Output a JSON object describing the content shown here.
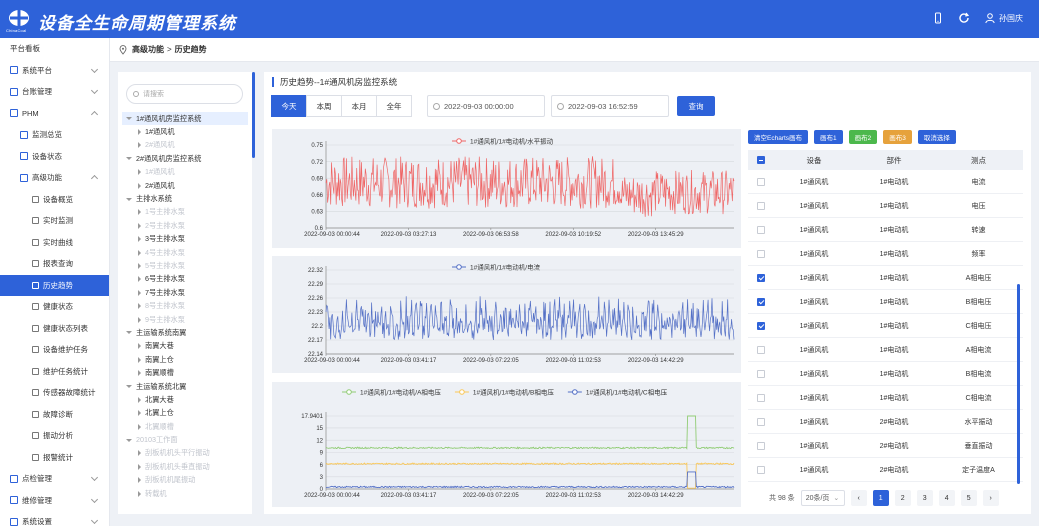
{
  "app": {
    "title": "设备全生命周期管理系统",
    "logo_text": "ChinaCoal",
    "user": "孙国庆"
  },
  "breadcrumb": {
    "root": "高级功能",
    "sep": ">",
    "current": "历史趋势"
  },
  "sidebar": [
    {
      "label": "平台看板",
      "icon": "",
      "level": 0,
      "expand": ""
    },
    {
      "label": "系统平台",
      "icon": "monitor-icon",
      "level": 0,
      "expand": "down"
    },
    {
      "label": "台账管理",
      "icon": "ledger-icon",
      "level": 0,
      "expand": "down"
    },
    {
      "label": "PHM",
      "icon": "phm-icon",
      "level": 0,
      "expand": "up"
    },
    {
      "label": "监测总览",
      "icon": "overview-icon",
      "level": 1,
      "expand": ""
    },
    {
      "label": "设备状态",
      "icon": "device-status-icon",
      "level": 1,
      "expand": ""
    },
    {
      "label": "高级功能",
      "icon": "advanced-icon",
      "level": 1,
      "expand": "up"
    },
    {
      "label": "设备概览",
      "icon": "page-icon",
      "level": 2,
      "expand": ""
    },
    {
      "label": "实时监测",
      "icon": "page-icon",
      "level": 2,
      "expand": ""
    },
    {
      "label": "实时曲线",
      "icon": "page-icon",
      "level": 2,
      "expand": ""
    },
    {
      "label": "报表查询",
      "icon": "page-icon",
      "level": 2,
      "expand": ""
    },
    {
      "label": "历史趋势",
      "icon": "page-icon",
      "level": 2,
      "expand": "",
      "active": true
    },
    {
      "label": "健康状态",
      "icon": "page-icon",
      "level": 2,
      "expand": ""
    },
    {
      "label": "健康状态列表",
      "icon": "page-icon",
      "level": 2,
      "expand": ""
    },
    {
      "label": "设备维护任务",
      "icon": "page-icon",
      "level": 2,
      "expand": ""
    },
    {
      "label": "维护任务统计",
      "icon": "page-icon",
      "level": 2,
      "expand": ""
    },
    {
      "label": "传感器故障统计",
      "icon": "page-icon",
      "level": 2,
      "expand": ""
    },
    {
      "label": "故障诊断",
      "icon": "page-icon",
      "level": 2,
      "expand": ""
    },
    {
      "label": "振动分析",
      "icon": "page-icon",
      "level": 2,
      "expand": ""
    },
    {
      "label": "报警统计",
      "icon": "page-icon",
      "level": 2,
      "expand": ""
    },
    {
      "label": "点检管理",
      "icon": "inspect-icon",
      "level": 0,
      "expand": "down"
    },
    {
      "label": "维修管理",
      "icon": "repair-icon",
      "level": 0,
      "expand": "down"
    },
    {
      "label": "系统设置",
      "icon": "settings-icon",
      "level": 0,
      "expand": "down"
    }
  ],
  "tree": {
    "search_placeholder": "请搜索",
    "nodes": [
      {
        "label": "1#通风机房监控系统",
        "level": 0,
        "toggle": "down",
        "selected": true
      },
      {
        "label": "1#通风机",
        "level": 1,
        "toggle": "right"
      },
      {
        "label": "2#通风机",
        "level": 1,
        "toggle": "right",
        "disabled": true
      },
      {
        "label": "2#通风机房监控系统",
        "level": 0,
        "toggle": "down"
      },
      {
        "label": "1#通风机",
        "level": 1,
        "toggle": "right",
        "disabled": true
      },
      {
        "label": "2#通风机",
        "level": 1,
        "toggle": "right"
      },
      {
        "label": "主排水系统",
        "level": 0,
        "toggle": "down"
      },
      {
        "label": "1号主排水泵",
        "level": 1,
        "toggle": "right",
        "disabled": true
      },
      {
        "label": "2号主排水泵",
        "level": 1,
        "toggle": "right",
        "disabled": true
      },
      {
        "label": "3号主排水泵",
        "level": 1,
        "toggle": "right"
      },
      {
        "label": "4号主排水泵",
        "level": 1,
        "toggle": "right",
        "disabled": true
      },
      {
        "label": "5号主排水泵",
        "level": 1,
        "toggle": "right",
        "disabled": true
      },
      {
        "label": "6号主排水泵",
        "level": 1,
        "toggle": "right"
      },
      {
        "label": "7号主排水泵",
        "level": 1,
        "toggle": "right"
      },
      {
        "label": "8号主排水泵",
        "level": 1,
        "toggle": "right",
        "disabled": true
      },
      {
        "label": "9号主排水泵",
        "level": 1,
        "toggle": "right",
        "disabled": true
      },
      {
        "label": "主运输系统南翼",
        "level": 0,
        "toggle": "down"
      },
      {
        "label": "南翼大巷",
        "level": 1,
        "toggle": "right"
      },
      {
        "label": "南翼上仓",
        "level": 1,
        "toggle": "right"
      },
      {
        "label": "南翼顺槽",
        "level": 1,
        "toggle": "right"
      },
      {
        "label": "主运输系统北翼",
        "level": 0,
        "toggle": "down"
      },
      {
        "label": "北翼大巷",
        "level": 1,
        "toggle": "right"
      },
      {
        "label": "北翼上仓",
        "level": 1,
        "toggle": "right"
      },
      {
        "label": "北翼顺槽",
        "level": 1,
        "toggle": "right",
        "disabled": true
      },
      {
        "label": "20103工作面",
        "level": 0,
        "toggle": "down",
        "disabled": true
      },
      {
        "label": "刮板机机头平行振动",
        "level": 1,
        "toggle": "right",
        "disabled": true
      },
      {
        "label": "刮板机机头垂直振动",
        "level": 1,
        "toggle": "right",
        "disabled": true
      },
      {
        "label": "刮板机机尾振动",
        "level": 1,
        "toggle": "right",
        "disabled": true
      },
      {
        "label": "转载机",
        "level": 1,
        "toggle": "right",
        "disabled": true
      }
    ]
  },
  "main": {
    "title": "历史趋势--1#通风机房监控系统",
    "range_tabs": [
      "今天",
      "本周",
      "本月",
      "全年"
    ],
    "active_tab": 0,
    "start_time": "2022-09-03 00:00:00",
    "end_time": "2022-09-03 16:52:59",
    "query_label": "查询"
  },
  "buttons": [
    {
      "label": "清空Echarts画布",
      "color": "#2e62d9"
    },
    {
      "label": "画布1",
      "color": "#2e62d9"
    },
    {
      "label": "画布2",
      "color": "#4cb84c"
    },
    {
      "label": "画布3",
      "color": "#e6a23c"
    },
    {
      "label": "取消选择",
      "color": "#2e62d9"
    }
  ],
  "table": {
    "headers": [
      "设备",
      "部件",
      "测点"
    ],
    "header_checkbox": true,
    "rows": [
      {
        "device": "1#通风机",
        "part": "1#电动机",
        "point": "电流",
        "checked": false
      },
      {
        "device": "1#通风机",
        "part": "1#电动机",
        "point": "电压",
        "checked": false
      },
      {
        "device": "1#通风机",
        "part": "1#电动机",
        "point": "转速",
        "checked": false
      },
      {
        "device": "1#通风机",
        "part": "1#电动机",
        "point": "频率",
        "checked": false
      },
      {
        "device": "1#通风机",
        "part": "1#电动机",
        "point": "A相电压",
        "checked": true
      },
      {
        "device": "1#通风机",
        "part": "1#电动机",
        "point": "B相电压",
        "checked": true
      },
      {
        "device": "1#通风机",
        "part": "1#电动机",
        "point": "C相电压",
        "checked": true
      },
      {
        "device": "1#通风机",
        "part": "1#电动机",
        "point": "A相电流",
        "checked": false
      },
      {
        "device": "1#通风机",
        "part": "1#电动机",
        "point": "B相电流",
        "checked": false
      },
      {
        "device": "1#通风机",
        "part": "1#电动机",
        "point": "C相电流",
        "checked": false
      },
      {
        "device": "1#通风机",
        "part": "2#电动机",
        "point": "水平振动",
        "checked": false
      },
      {
        "device": "1#通风机",
        "part": "2#电动机",
        "point": "垂直振动",
        "checked": false
      },
      {
        "device": "1#通风机",
        "part": "2#电动机",
        "point": "定子温度A",
        "checked": false
      }
    ]
  },
  "pager": {
    "total": "共 98 条",
    "page_size": "20条/页",
    "pages": [
      "1",
      "2",
      "3",
      "4",
      "5"
    ],
    "current": "1"
  },
  "chart_data": [
    {
      "type": "line",
      "series": [
        {
          "name": "1#通风机/1#电动机/水平振动",
          "color": "#ef6666"
        }
      ],
      "x_ticks": [
        "2022-09-03 00:00:44",
        "2022-09-03 03:27:13",
        "2022-09-03 06:53:58",
        "2022-09-03 10:19:52",
        "2022-09-03 13:45:29"
      ],
      "y_ticks": [
        "0.6",
        "0.63",
        "0.66",
        "0.69",
        "0.72",
        "0.75"
      ],
      "ylim": [
        0.6,
        0.75
      ],
      "shape": {
        "lo": 0.635,
        "hi": 0.73,
        "lo2": 0.62,
        "hi2": 0.7
      }
    },
    {
      "type": "line",
      "series": [
        {
          "name": "1#通风机/1#电动机/电流",
          "color": "#5470c6"
        }
      ],
      "x_ticks": [
        "2022-09-03 00:00:44",
        "2022-09-03 03:41:17",
        "2022-09-03 07:22:05",
        "2022-09-03 11:02:53",
        "2022-09-03 14:42:29"
      ],
      "y_ticks": [
        "22.14",
        "22.17",
        "22.2",
        "22.23",
        "22.26",
        "22.29",
        "22.32"
      ],
      "ylim": [
        22.14,
        22.32
      ],
      "shape": {
        "lo": 22.17,
        "hi": 22.27
      }
    },
    {
      "type": "line",
      "series": [
        {
          "name": "1#通风机/1#电动机/A相电压",
          "color": "#91cc75",
          "level": 10.1
        },
        {
          "name": "1#通风机/1#电动机/B相电压",
          "color": "#fac858",
          "level": 6.2
        },
        {
          "name": "1#通风机/1#电动机/C相电压",
          "color": "#5470c6",
          "level": 0.5
        }
      ],
      "x_ticks": [
        "2022-09-03 00:00:44",
        "2022-09-03 03:41:17",
        "2022-09-03 07:22:05",
        "2022-09-03 11:02:53",
        "2022-09-03 14:42:29"
      ],
      "y_ticks": [
        "0",
        "3",
        "6",
        "9",
        "12",
        "15",
        "17.9401"
      ],
      "ylim": [
        0,
        17.9401
      ]
    }
  ]
}
